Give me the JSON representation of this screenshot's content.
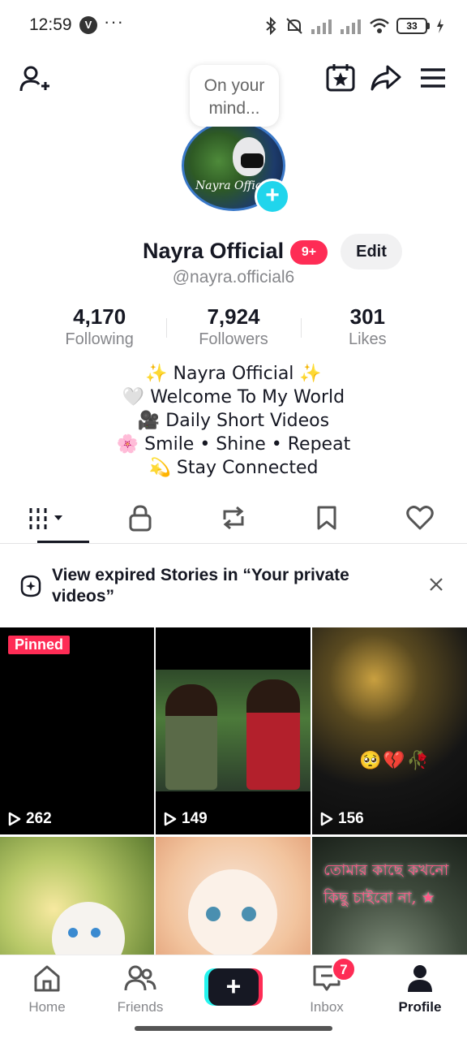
{
  "status_bar": {
    "time": "12:59",
    "vpn_badge": "V",
    "more": "···",
    "battery": "33"
  },
  "note": {
    "text": "On your mind..."
  },
  "profile": {
    "name": "Nayra Official",
    "badge": "9+",
    "edit_label": "Edit",
    "handle": "@nayra.official6",
    "avatar_caption": "Nayra Official",
    "stats": [
      {
        "value": "4,170",
        "label": "Following"
      },
      {
        "value": "7,924",
        "label": "Followers"
      },
      {
        "value": "301",
        "label": "Likes"
      }
    ],
    "bio": [
      "✨ Nayra Official ✨",
      "🤍 Welcome To My World",
      "🎥 Daily Short Videos",
      "🌸 Smile • Shine • Repeat",
      "💫 Stay Connected"
    ]
  },
  "tabs": [
    {
      "icon": "grid-icon"
    },
    {
      "icon": "lock-icon"
    },
    {
      "icon": "repost-icon"
    },
    {
      "icon": "bookmark-icon"
    },
    {
      "icon": "heart-icon"
    }
  ],
  "banner": {
    "text": "View expired Stories in “Your private videos”"
  },
  "videos": [
    {
      "views": "262",
      "pinned": "Pinned"
    },
    {
      "views": "149"
    },
    {
      "views": "156"
    },
    {
      "views": ""
    },
    {
      "views": ""
    },
    {
      "views": "",
      "overlay_text": "তোমার কাছে কখনো কিছু চাইবো না, ★"
    }
  ],
  "bottom_nav": {
    "home": "Home",
    "friends": "Friends",
    "create": "+",
    "inbox": "Inbox",
    "inbox_badge": "7",
    "profile": "Profile"
  },
  "colors": {
    "accent": "#fe2c55",
    "cyan": "#25f4ee",
    "text": "#161823",
    "muted": "#86878b"
  }
}
